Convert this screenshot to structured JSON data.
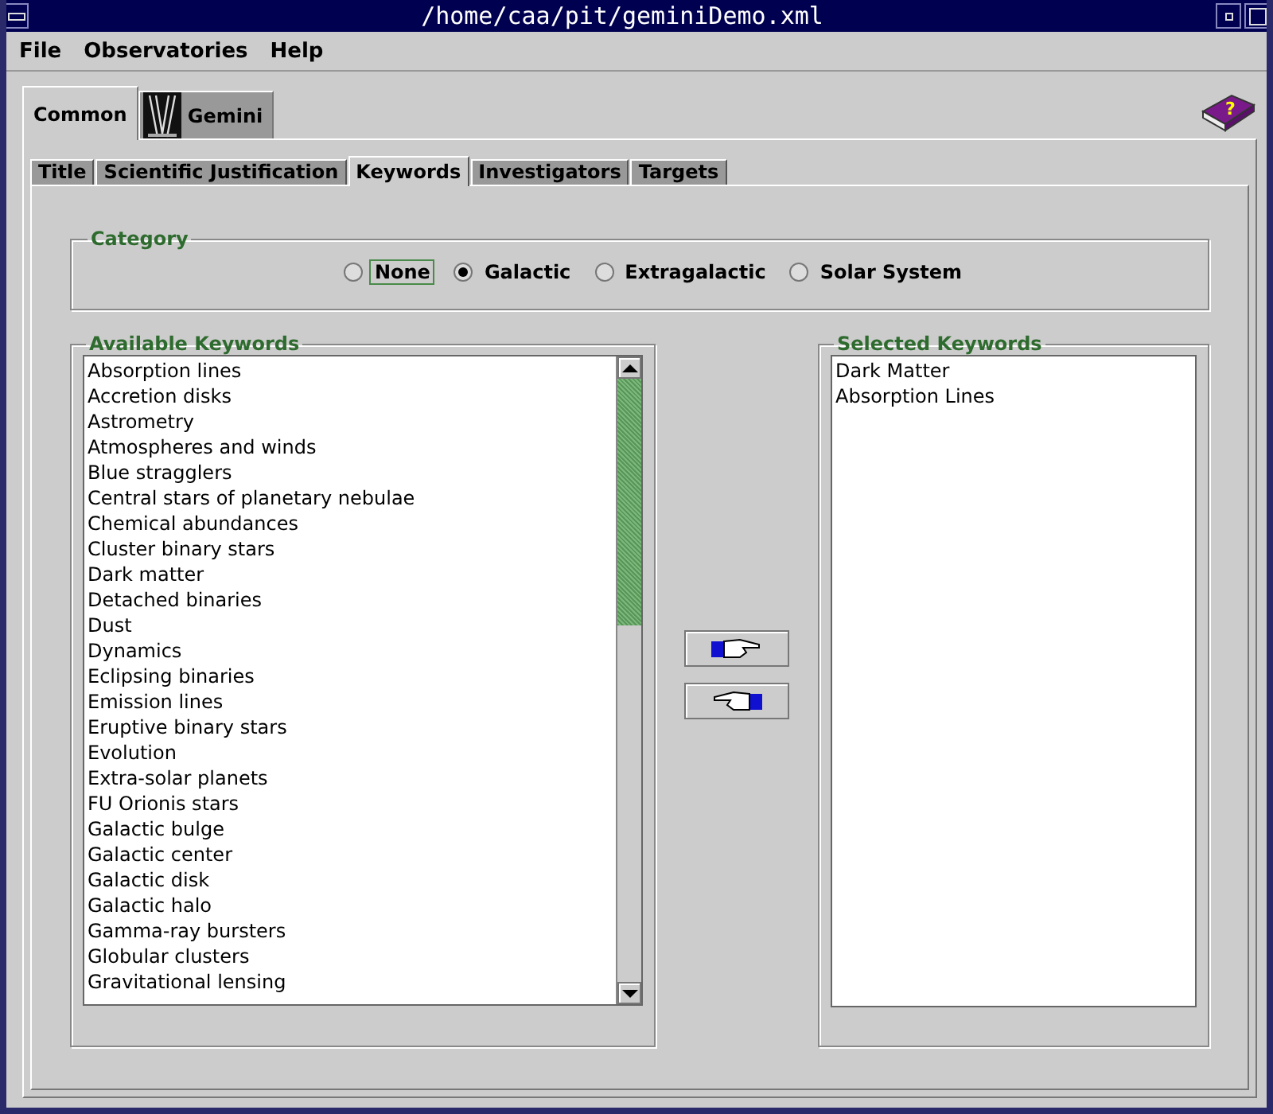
{
  "window": {
    "title": "/home/caa/pit/geminiDemo.xml"
  },
  "menu": [
    "File",
    "Observatories",
    "Help"
  ],
  "help_icon": {
    "glyph": "?"
  },
  "outer_tabs": [
    {
      "label": "Common",
      "selected": true,
      "kind": "text"
    },
    {
      "label": "Gemini",
      "selected": false,
      "kind": "logo"
    }
  ],
  "inner_tabs": [
    {
      "label": "Title",
      "selected": false
    },
    {
      "label": "Scientific Justification",
      "selected": false
    },
    {
      "label": "Keywords",
      "selected": true
    },
    {
      "label": "Investigators",
      "selected": false
    },
    {
      "label": "Targets",
      "selected": false
    }
  ],
  "category": {
    "title": "Category",
    "options": [
      {
        "label": "None",
        "selected": false,
        "focused": true
      },
      {
        "label": "Galactic",
        "selected": true,
        "focused": false
      },
      {
        "label": "Extragalactic",
        "selected": false,
        "focused": false
      },
      {
        "label": "Solar System",
        "selected": false,
        "focused": false
      }
    ]
  },
  "available": {
    "title": "Available Keywords",
    "items": [
      "Absorption lines",
      "Accretion disks",
      "Astrometry",
      "Atmospheres and winds",
      "Blue stragglers",
      "Central stars of planetary nebulae",
      "Chemical abundances",
      "Cluster binary stars",
      "Dark matter",
      "Detached binaries",
      "Dust",
      "Dynamics",
      "Eclipsing binaries",
      "Emission lines",
      "Eruptive binary stars",
      "Evolution",
      "Extra-solar planets",
      "FU Orionis stars",
      "Galactic bulge",
      "Galactic center",
      "Galactic disk",
      "Galactic halo",
      "Gamma-ray bursters",
      "Globular clusters",
      "Gravitational lensing"
    ]
  },
  "selected": {
    "title": "Selected Keywords",
    "items": [
      "Dark Matter",
      "Absorption Lines"
    ]
  }
}
